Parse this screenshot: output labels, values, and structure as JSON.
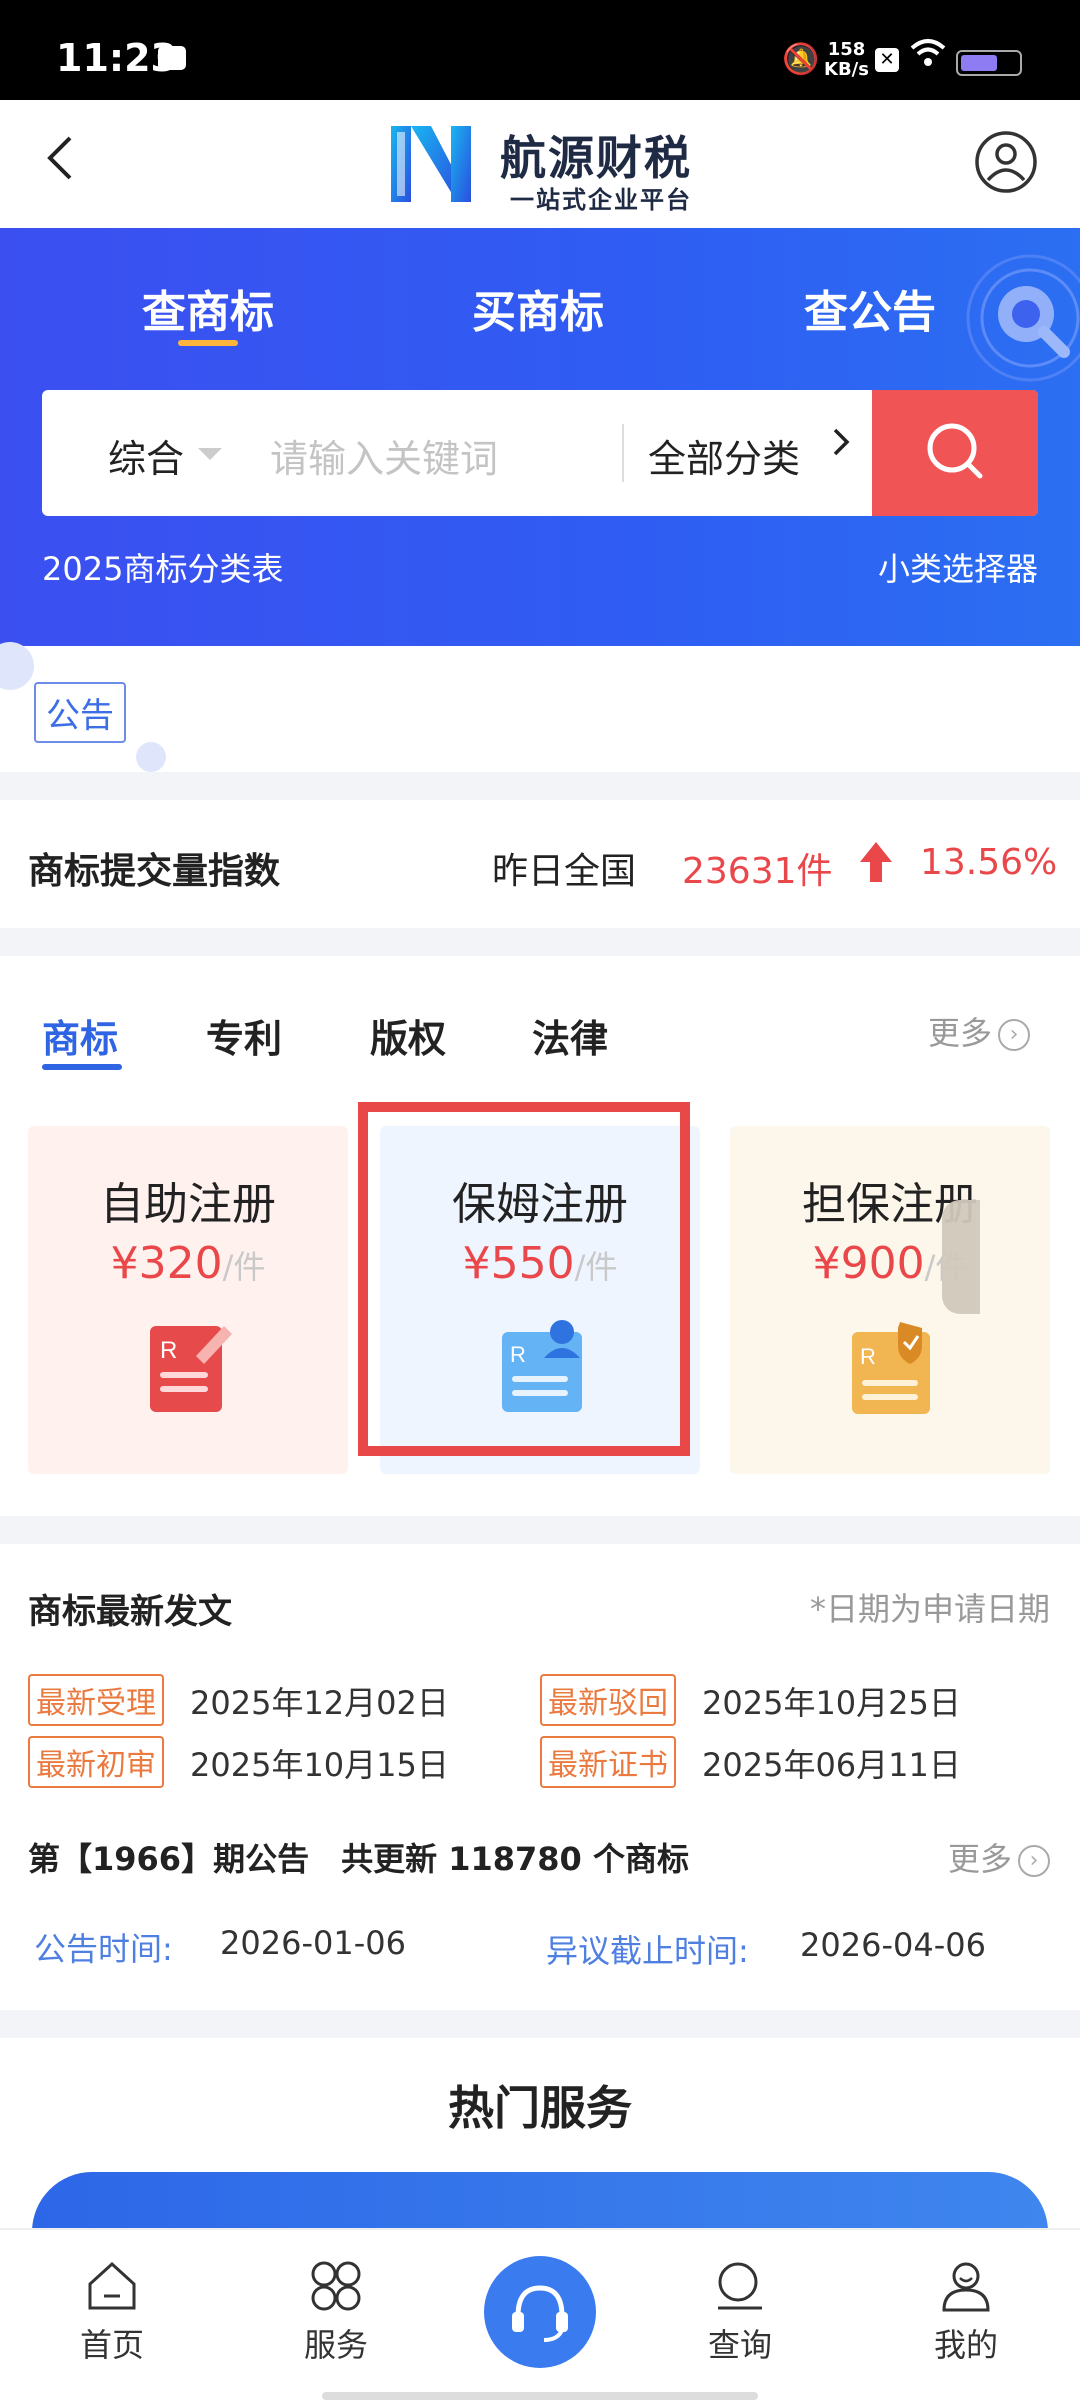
{
  "status": {
    "time": "11:23",
    "net_speed_value": "158",
    "net_speed_unit": "KB/s"
  },
  "header": {
    "brand_name": "航源财税",
    "brand_tagline": "一站式企业平台"
  },
  "hero": {
    "tabs": [
      "查商标",
      "买商标",
      "查公告"
    ],
    "active_tab": "查商标",
    "search": {
      "type_label": "综合",
      "placeholder": "请输入关键词",
      "category_label": "全部分类"
    },
    "link_left": "2025商标分类表",
    "link_right": "小类选择器"
  },
  "notice": {
    "badge": "公告"
  },
  "index": {
    "title": "商标提交量指数",
    "label": "昨日全国",
    "count": "23631件",
    "percent": "13.56%"
  },
  "services": {
    "tabs": [
      "商标",
      "专利",
      "版权",
      "法律"
    ],
    "active_tab": "商标",
    "more_label": "更多",
    "cards": [
      {
        "title": "自助注册",
        "price": "¥320",
        "unit": "/件",
        "icon": "trademark-pen-icon"
      },
      {
        "title": "保姆注册",
        "price": "¥550",
        "unit": "/件",
        "icon": "trademark-person-icon"
      },
      {
        "title": "担保注册",
        "price": "¥900",
        "unit": "/件",
        "icon": "trademark-shield-icon"
      }
    ]
  },
  "docs": {
    "title": "商标最新发文",
    "note": "*日期为申请日期",
    "items": [
      {
        "tag": "最新受理",
        "date": "2025年12月02日"
      },
      {
        "tag": "最新驳回",
        "date": "2025年10月25日"
      },
      {
        "tag": "最新初审",
        "date": "2025年10月15日"
      },
      {
        "tag": "最新证书",
        "date": "2025年06月11日"
      }
    ],
    "period_text": "第【1966】期公告　共更新 118780 个商标",
    "more_label": "更多",
    "publish_label": "公告时间:",
    "publish_value": "2026-01-06",
    "objection_label": "异议截止时间:",
    "objection_value": "2026-04-06"
  },
  "hot": {
    "title": "热门服务"
  },
  "nav": {
    "items": [
      "首页",
      "服务",
      "查询",
      "我的"
    ]
  },
  "colors": {
    "primary_blue": "#3050f0",
    "accent_red": "#e9474a",
    "tag_orange": "#ea7a3f"
  }
}
